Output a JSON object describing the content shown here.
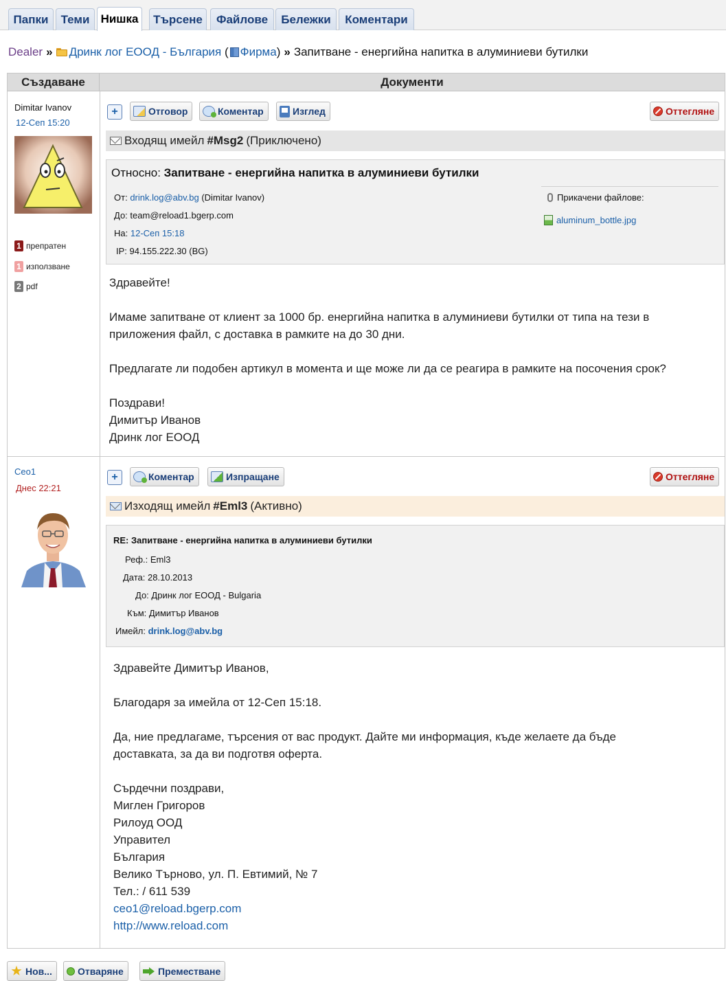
{
  "tabs": [
    "Папки",
    "Теми",
    "Нишка",
    "Търсене",
    "Файлове",
    "Бележки",
    "Коментари"
  ],
  "active_tab": "Нишка",
  "breadcrumb": {
    "root": "Dealer",
    "separator": "»",
    "company": "Дринк лог ЕООД - България",
    "firm_open": "(",
    "firm_label": "Фирма",
    "firm_close": ")",
    "thread_title": "Запитване - енергийна напитка в алуминиеви бутилки"
  },
  "table_headers": {
    "left": "Създаване",
    "right": "Документи"
  },
  "posts": [
    {
      "author": "Dimitar Ivanov",
      "time": "12-Сеп 15:20",
      "stats": [
        {
          "count": "1",
          "label": "препратен",
          "color": "#8b1a1a"
        },
        {
          "count": "1",
          "label": "използване",
          "color": "#f0a0a0"
        },
        {
          "count": "2",
          "label": "pdf",
          "color": "#777777"
        }
      ],
      "toolbar": {
        "plus": "+",
        "reply": "Отговор",
        "comment": "Коментар",
        "view": "Изглед",
        "reject": "Оттегляне"
      },
      "doc": {
        "prefix": "Входящ имейл",
        "number": "#Msg2",
        "status": "(Приключено)"
      },
      "header": {
        "subject_label": "Относно:",
        "subject": "Запитване - енергийна напитка в алуминиеви бутилки",
        "from_label": "От:",
        "from_email": "drink.log@abv.bg",
        "from_name": "(Dimitar Ivanov)",
        "to_label": "До:",
        "to": "team@reload1.bgerp.com",
        "on_label": "На:",
        "on": "12-Сеп 15:18",
        "ip_label": "IP:",
        "ip": "94.155.222.30 (BG)",
        "attachments_label": "Прикачени файлове:",
        "attachment": "aluminum_bottle.jpg"
      },
      "body": {
        "greeting": "Здравейте!",
        "p1": "Имаме запитване от клиент за 1000 бр. енергийна напитка в алуминиеви бутилки от типа на тези в приложения файл, с доставка в рамките на до 30 дни.",
        "p2": "Предлагате ли подобен артикул в момента и ще може ли да се реагира в рамките на посочения срок?",
        "sign1": "Поздрави!",
        "sign2": "Димитър Иванов",
        "sign3": "Дринк лог ЕООД"
      }
    },
    {
      "author": "Ceo1",
      "time": "Днес 22:21",
      "toolbar": {
        "plus": "+",
        "comment": "Коментар",
        "send": "Изпращане",
        "reject": "Оттегляне"
      },
      "doc": {
        "prefix": "Изходящ имейл",
        "number": "#Eml3",
        "status": "(Активно)"
      },
      "header": {
        "subject": "RE: Запитване - енергийна напитка в алуминиеви бутилки",
        "ref_label": "Реф.:",
        "ref": "Eml3",
        "date_label": "Дата:",
        "date": "28.10.2013",
        "to_label": "До:",
        "to": "Дринк лог ЕООД - Bulgaria",
        "attn_label": "Към:",
        "attn": "Димитър Иванов",
        "email_label": "Имейл:",
        "email": "drink.log@abv.bg"
      },
      "body": {
        "greeting": "Здравейте Димитър Иванов,",
        "p1": "Благодаря за имейла от 12-Сеп 15:18.",
        "p2": "Да, ние предлагаме, търсения от вас продукт. Дайте ми информация, къде желаете да бъде доставката, за да ви подготвя оферта.",
        "sign": [
          "Сърдечни поздрави,",
          "Миглен Григоров",
          "Рилоуд ООД",
          "Управител",
          "България",
          "Велико Търново, ул. П. Евтимий, № 7",
          "Тел.: / 611 539"
        ],
        "email": "ceo1@reload.bgerp.com",
        "url": "http://www.reload.com"
      }
    }
  ],
  "bottom_buttons": {
    "new": "Нов...",
    "open": "Отваряне",
    "move": "Преместване"
  }
}
